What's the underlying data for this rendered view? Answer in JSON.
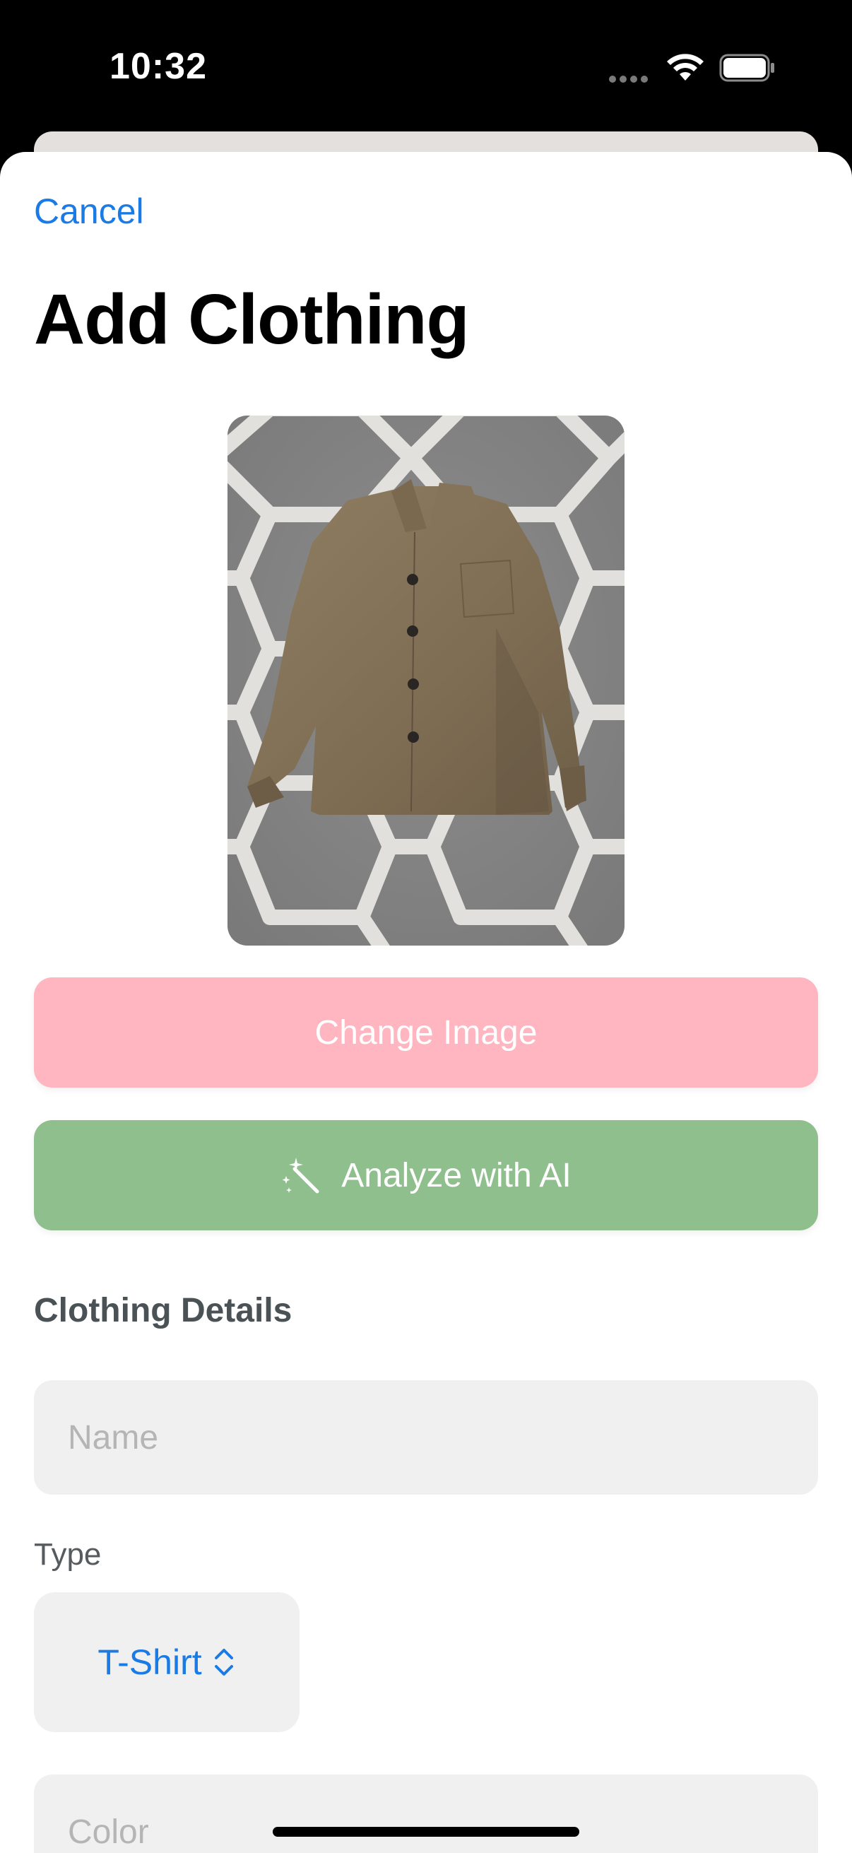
{
  "status_bar": {
    "time": "10:32"
  },
  "header": {
    "cancel_label": "Cancel",
    "title": "Add Clothing"
  },
  "photo": {
    "subject": "brown wool shirt jacket on gray patterned rug"
  },
  "actions": {
    "change_image_label": "Change Image",
    "analyze_label": "Analyze with AI",
    "analyze_icon": "magic-wand-icon"
  },
  "details": {
    "section_title": "Clothing Details",
    "name_placeholder": "Name",
    "name_value": "",
    "type_label": "Type",
    "type_value": "T-Shirt",
    "color_placeholder": "Color",
    "color_value": ""
  },
  "colors": {
    "accent_blue": "#1a7ae6",
    "change_image_bg": "#ffb6c1",
    "analyze_bg": "#8fbf8c",
    "field_bg": "#f0f0f0"
  }
}
